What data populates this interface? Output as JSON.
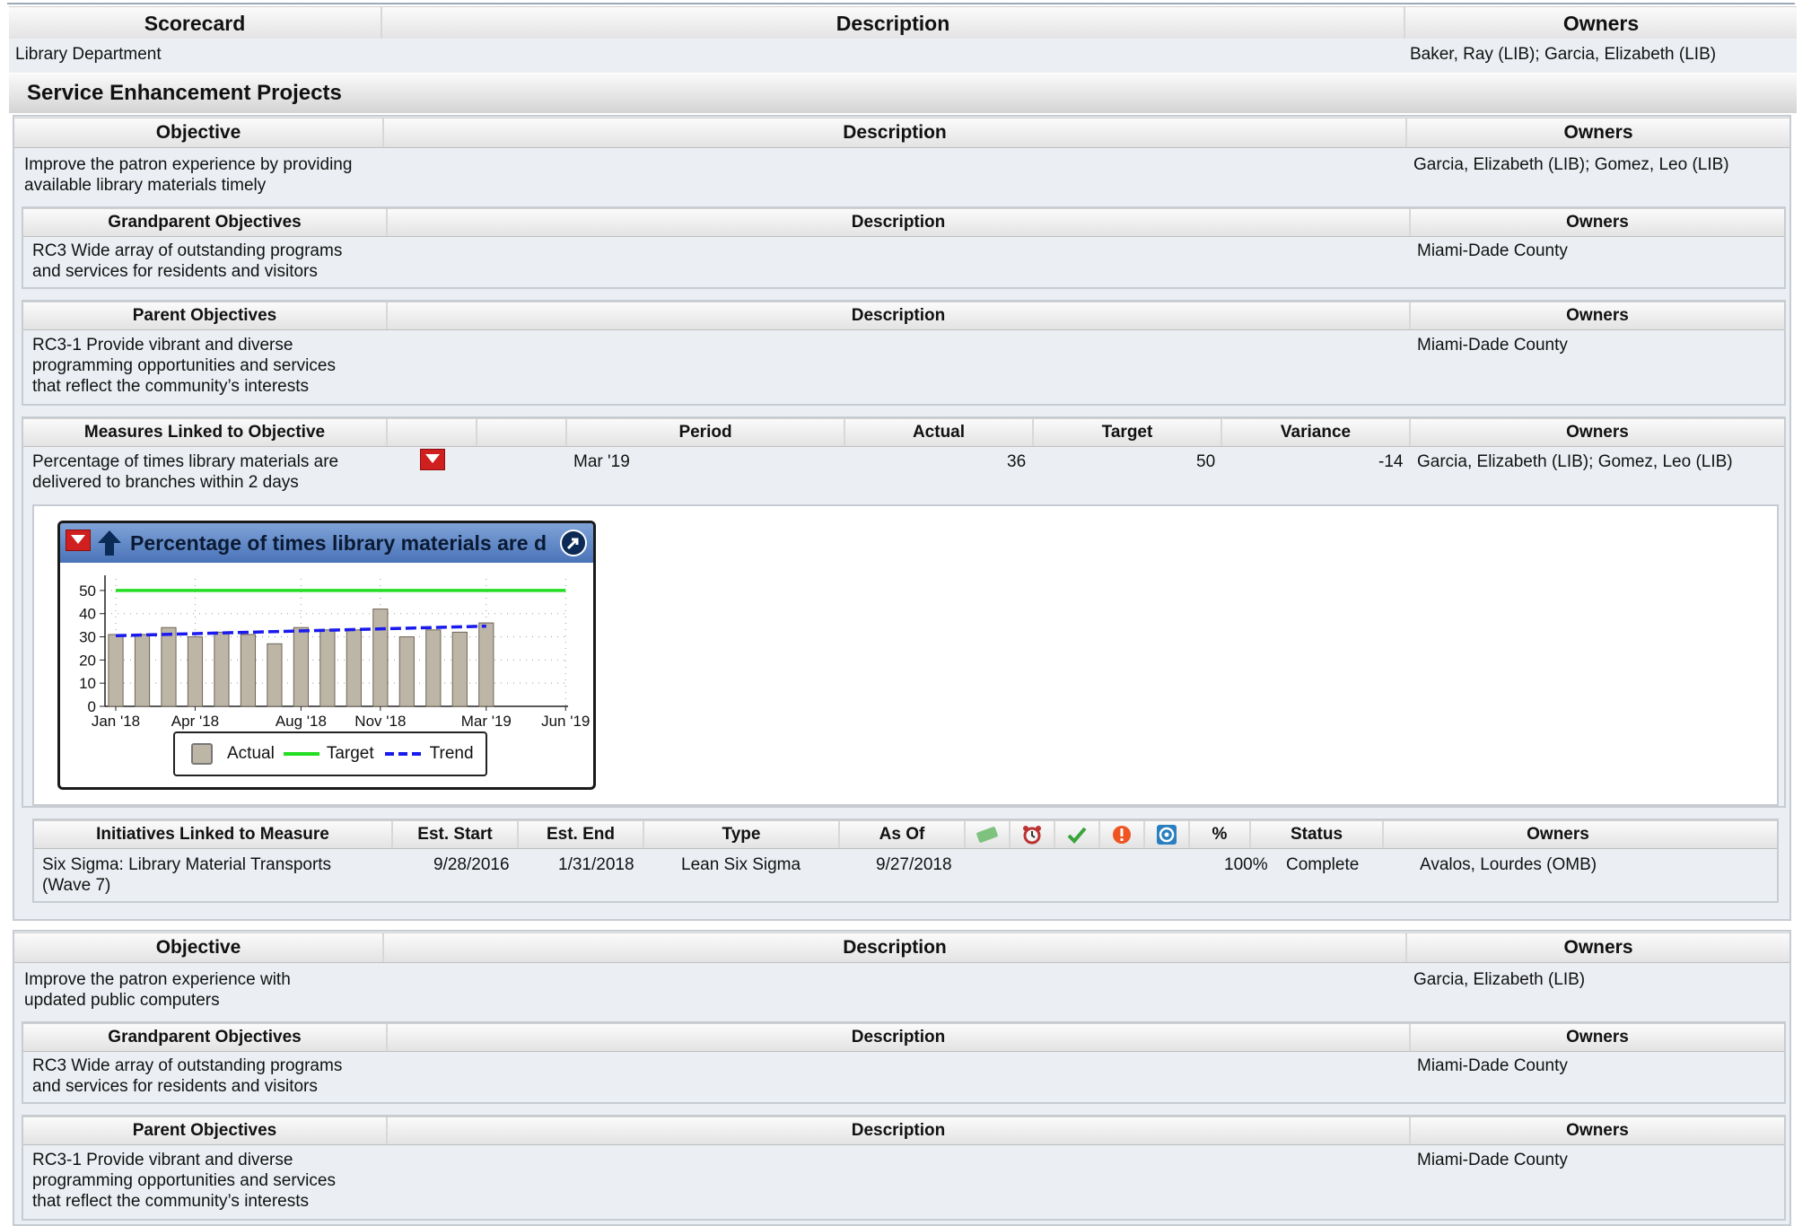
{
  "scorecard_header": {
    "col1": "Scorecard",
    "col2": "Description",
    "col3": "Owners"
  },
  "scorecard_row": {
    "name": "Library Department",
    "owners": "Baker, Ray (LIB); Garcia, Elizabeth (LIB)"
  },
  "section_title": "Service Enhancement Projects",
  "objective1": {
    "header": {
      "col1": "Objective",
      "col2": "Description",
      "col3": "Owners"
    },
    "name_lines": [
      "Improve the patron experience by providing",
      "available library materials timely"
    ],
    "owners": "Garcia, Elizabeth (LIB); Gomez, Leo (LIB)",
    "grandparent": {
      "header": {
        "col1": "Grandparent Objectives",
        "col2": "Description",
        "col3": "Owners"
      },
      "lines": [
        "RC3 Wide array of outstanding programs",
        "and services for residents and visitors"
      ],
      "owners": "Miami-Dade County"
    },
    "parent": {
      "header": {
        "col1": "Parent Objectives",
        "col2": "Description",
        "col3": "Owners"
      },
      "lines": [
        "RC3-1 Provide vibrant and diverse",
        "programming opportunities  and services",
        "that reflect the community’s interests"
      ],
      "owners": "Miami-Dade County"
    },
    "measures": {
      "header": {
        "col1": "Measures Linked to Objective",
        "period": "Period",
        "actual": "Actual",
        "target": "Target",
        "variance": "Variance",
        "owners": "Owners"
      },
      "row": {
        "lines": [
          "Percentage of times library materials are",
          "delivered to branches within 2 days"
        ],
        "period": "Mar '19",
        "actual": "36",
        "target": "50",
        "variance": "-14",
        "owners": "Garcia, Elizabeth (LIB); Gomez, Leo (LIB)"
      }
    },
    "initiatives": {
      "header": {
        "col1": "Initiatives Linked to Measure",
        "est_start": "Est. Start",
        "est_end": "Est. End",
        "type": "Type",
        "as_of": "As Of",
        "pct": "%",
        "status": "Status",
        "owners": "Owners"
      },
      "row": {
        "lines": [
          "Six Sigma: Library Material Transports",
          "(Wave 7)"
        ],
        "est_start": "9/28/2016",
        "est_end": "1/31/2018",
        "type": "Lean Six Sigma",
        "as_of": "9/27/2018",
        "pct": "100%",
        "status": "Complete",
        "owners": "Avalos, Lourdes (OMB)"
      }
    }
  },
  "objective2": {
    "header": {
      "col1": "Objective",
      "col2": "Description",
      "col3": "Owners"
    },
    "name_lines": [
      "Improve the patron experience with",
      "updated public computers"
    ],
    "owners": "Garcia, Elizabeth (LIB)",
    "grandparent": {
      "header": {
        "col1": "Grandparent Objectives",
        "col2": "Description",
        "col3": "Owners"
      },
      "lines": [
        "RC3 Wide array of outstanding programs",
        "and services for residents and visitors"
      ],
      "owners": "Miami-Dade County"
    },
    "parent": {
      "header": {
        "col1": "Parent Objectives",
        "col2": "Description",
        "col3": "Owners"
      },
      "lines": [
        "RC3-1 Provide vibrant and diverse",
        "programming opportunities  and services",
        "that reflect the community’s interests"
      ],
      "owners": "Miami-Dade County"
    }
  },
  "icons": [
    "money-icon",
    "alarm-clock-icon",
    "checkmark-icon",
    "warning-icon",
    "target-icon"
  ],
  "colors": {
    "actual_bar": "#bdb5a6",
    "target_line": "#22dd22",
    "trend_line": "#1a1aee",
    "flag_red": "#d01f1f"
  },
  "chart_data": {
    "type": "bar",
    "title": "Percentage of times library materials are d",
    "categories": [
      "Jan '18",
      "Feb '18",
      "Mar '18",
      "Apr '18",
      "May '18",
      "Jun '18",
      "Jul '18",
      "Aug '18",
      "Sep '18",
      "Oct '18",
      "Nov '18",
      "Dec '18",
      "Jan '19",
      "Feb '19",
      "Mar '19",
      "Apr '19",
      "May '19",
      "Jun '19"
    ],
    "x_tick_labels": [
      "Jan '18",
      "Apr '18",
      "Aug '18",
      "Nov '18",
      "Mar '19",
      "Jun '19"
    ],
    "y_ticks": [
      "0",
      "10",
      "20",
      "30",
      "40",
      "50"
    ],
    "ylim": [
      0,
      55
    ],
    "series": [
      {
        "name": "Actual",
        "values": [
          31,
          31,
          34,
          30,
          32,
          31,
          27,
          34,
          33,
          33,
          42,
          30,
          33,
          32,
          36,
          null,
          null,
          null
        ]
      },
      {
        "name": "Target",
        "values": [
          50,
          50,
          50,
          50,
          50,
          50,
          50,
          50,
          50,
          50,
          50,
          50,
          50,
          50,
          50,
          50,
          50,
          50
        ]
      },
      {
        "name": "Trend",
        "values": [
          30.5,
          31.0,
          31.3,
          31.6,
          31.9,
          32.1,
          32.4,
          32.7,
          33.0,
          33.3,
          33.5,
          33.8,
          34.0,
          34.3,
          34.6,
          null,
          null,
          null
        ]
      }
    ],
    "legend": [
      "Actual",
      "Target",
      "Trend"
    ],
    "legend_position": "bottom"
  }
}
